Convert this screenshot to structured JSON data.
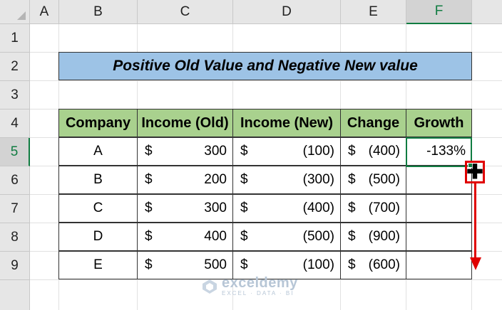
{
  "columns": [
    "A",
    "B",
    "C",
    "D",
    "E",
    "F"
  ],
  "rows": [
    "1",
    "2",
    "3",
    "4",
    "5",
    "6",
    "7",
    "8",
    "9"
  ],
  "selected_cell": {
    "column": "F",
    "row": "5"
  },
  "title": "Positive Old Value and Negative New value",
  "table": {
    "headers": [
      "Company",
      "Income (Old)",
      "Income (New)",
      "Change",
      "Growth"
    ],
    "currency_symbol": "$",
    "rows": [
      {
        "company": "A",
        "income_old": "300",
        "income_new": "(100)",
        "change": "(400)",
        "growth": "-133%"
      },
      {
        "company": "B",
        "income_old": "200",
        "income_new": "(300)",
        "change": "(500)",
        "growth": ""
      },
      {
        "company": "C",
        "income_old": "300",
        "income_new": "(400)",
        "change": "(700)",
        "growth": ""
      },
      {
        "company": "D",
        "income_old": "400",
        "income_new": "(500)",
        "change": "(900)",
        "growth": ""
      },
      {
        "company": "E",
        "income_old": "500",
        "income_new": "(100)",
        "change": "(600)",
        "growth": ""
      }
    ]
  },
  "colors": {
    "title_fill": "#9dc3e6",
    "header_fill": "#a9d18e",
    "selection": "#107c41",
    "annotation": "#e00000"
  },
  "watermark": {
    "name": "exceldemy",
    "tagline": "EXCEL · DATA · BI"
  }
}
